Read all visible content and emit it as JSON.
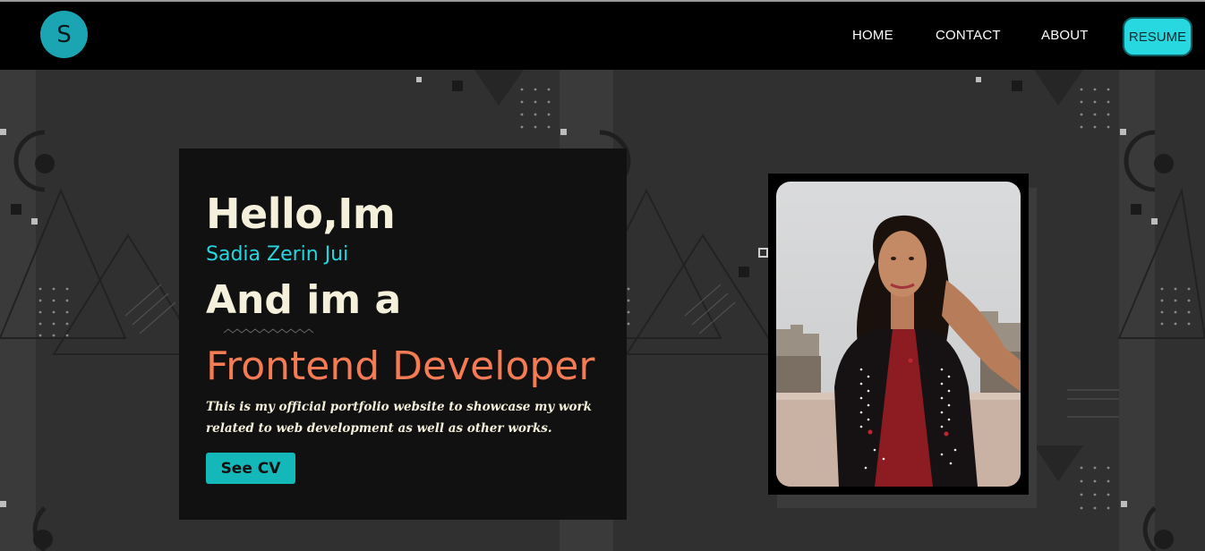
{
  "nav": {
    "logo_letter": "S",
    "links": [
      "HOME",
      "CONTACT",
      "ABOUT"
    ],
    "resume_label": "RESUME"
  },
  "hero": {
    "greeting": "Hello,Im",
    "name": "Sadia Zerin Jui",
    "and_im": "And im a",
    "role": "Frontend Developer",
    "tagline": "This is my official portfolio website to showcase my work related to web development as well as other works.",
    "cta_label": "See CV"
  },
  "colors": {
    "accent": "#25d6e0",
    "role": "#f47b53",
    "cream": "#f5f0dc",
    "button": "#14b8b8",
    "nav_bg": "#000000",
    "page_bg": "#2f2f2f"
  },
  "icons": {
    "logo": "letter-s-circle"
  }
}
